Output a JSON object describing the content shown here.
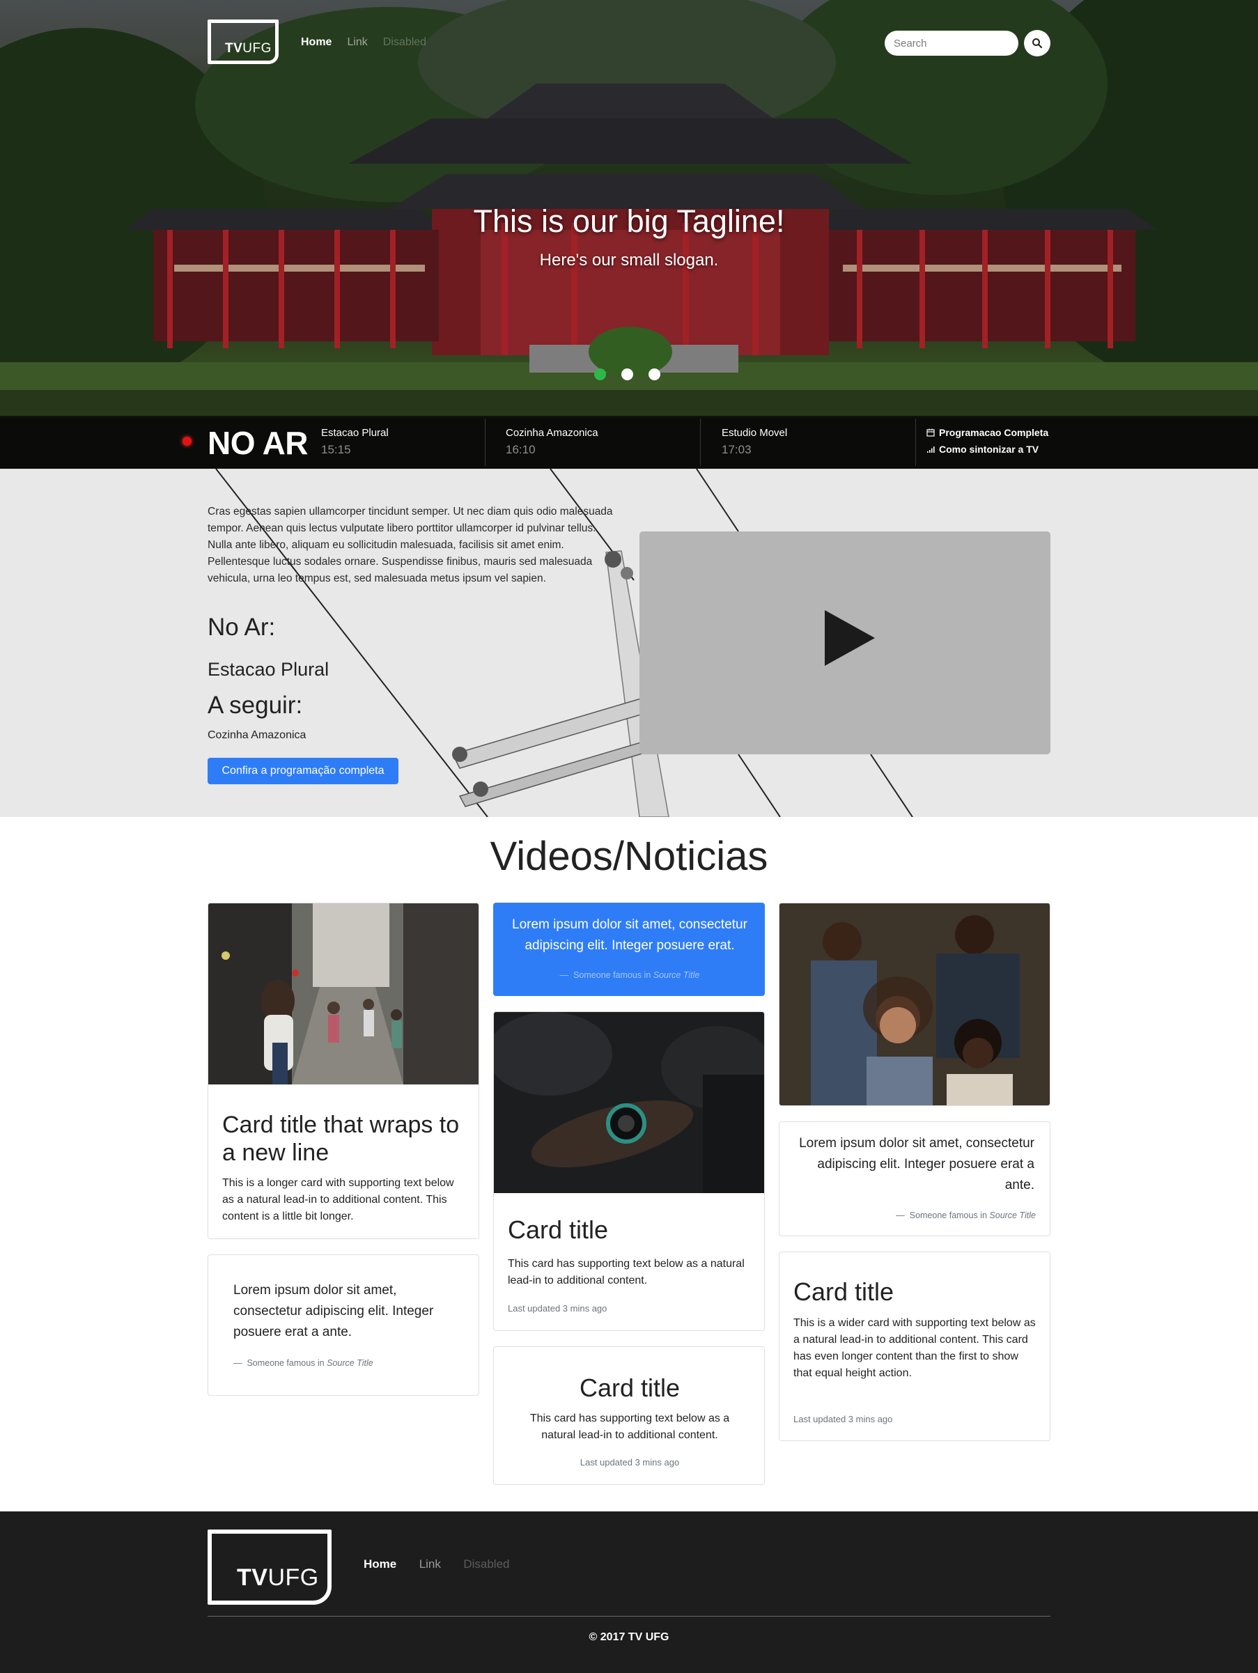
{
  "brand": {
    "logo_bold": "TV",
    "logo_light": "UFG"
  },
  "nav": {
    "home": "Home",
    "link": "Link",
    "disabled": "Disabled"
  },
  "search": {
    "placeholder": "Search"
  },
  "hero": {
    "tagline": "This is our big Tagline!",
    "slogan": "Here's our small slogan.",
    "carousel_active": 1,
    "carousel_count": 3
  },
  "on_air_bar": {
    "label": "NO AR",
    "schedule": [
      {
        "name": "Estacao Plural",
        "time": "15:15"
      },
      {
        "name": "Cozinha Amazonica",
        "time": "16:10"
      },
      {
        "name": "Estudio Movel",
        "time": "17:03"
      }
    ],
    "links": {
      "full_schedule": "Programacao Completa",
      "tune_in": "Como sintonizar a TV"
    }
  },
  "now_playing": {
    "intro": "Cras egestas sapien ullamcorper tincidunt semper. Ut nec diam quis odio malesuada tempor. Aenean quis lectus vulputate libero porttitor ullamcorper id pulvinar tellus. Nulla ante libero, aliquam eu sollicitudin malesuada, facilisis sit amet enim. Pellentesque luctus sodales ornare. Suspendisse finibus, mauris sed malesuada vehicula, urna leo tempus est, sed malesuada metus ipsum vel sapien.",
    "heading_now": "No Ar:",
    "program_now": "Estacao Plural",
    "heading_next": "A seguir:",
    "program_next": "Cozinha Amazonica",
    "button": "Confira a programação completa"
  },
  "videos": {
    "title": "Videos/Noticias",
    "card1": {
      "title": "Card title that wraps to a new line",
      "text": "This is a longer card with supporting text below as a natural lead-in to additional content. This content is a little bit longer."
    },
    "quote1": {
      "text": "Lorem ipsum dolor sit amet, consectetur adipiscing elit. Integer posuere erat a ante.",
      "author": "Someone famous in",
      "source": "Source Title"
    },
    "quote_blue": {
      "text": "Lorem ipsum dolor sit amet, consectetur adipiscing elit. Integer posuere erat.",
      "author": "Someone famous in",
      "source": "Source Title"
    },
    "card2": {
      "title": "Card title",
      "text": "This card has supporting text below as a natural lead-in to additional content.",
      "updated": "Last updated 3 mins ago"
    },
    "card3": {
      "title": "Card title",
      "text": "This card has supporting text below as a natural lead-in to additional content.",
      "updated": "Last updated 3 mins ago"
    },
    "quote2": {
      "text": "Lorem ipsum dolor sit amet, consectetur adipiscing elit. Integer posuere erat a ante.",
      "author": "Someone famous in",
      "source": "Source Title"
    },
    "card4": {
      "title": "Card title",
      "text": "This is a wider card with supporting text below as a natural lead-in to additional content. This card has even longer content than the first to show that equal height action.",
      "updated": "Last updated 3 mins ago"
    }
  },
  "footer": {
    "home": "Home",
    "link": "Link",
    "disabled": "Disabled",
    "copyright": "© 2017 TV UFG"
  },
  "colors": {
    "primary": "#2f7df6",
    "live": "#e01414",
    "carousel_active": "#2eb84b",
    "footer_bg": "#1d1d1d"
  }
}
